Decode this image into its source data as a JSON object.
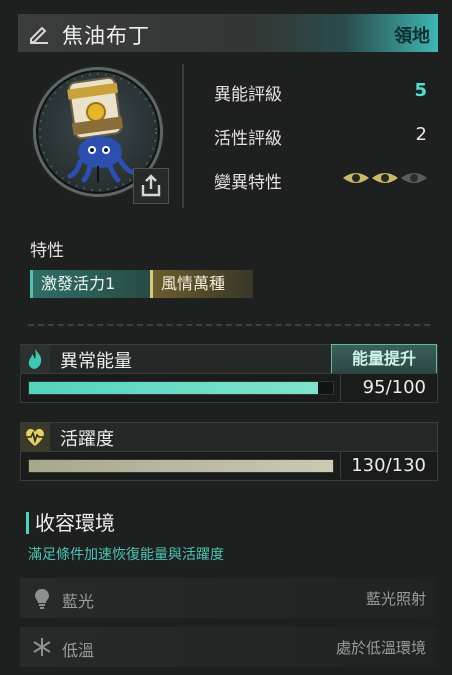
{
  "header": {
    "name": "焦油布丁",
    "tag": "領地",
    "edit_icon": "pencil-icon"
  },
  "stats": [
    {
      "label": "異能評級",
      "value": "5"
    },
    {
      "label": "活性評級",
      "value": "2"
    },
    {
      "label": "變異特性",
      "value": ""
    }
  ],
  "mutation_eyes": {
    "filled": 2,
    "total": 3
  },
  "traits": {
    "title": "特性",
    "chips": [
      "激發活力1",
      "風情萬種"
    ]
  },
  "energy": {
    "title": "異常能量",
    "boost_label": "能量提升",
    "value_text": "95/100",
    "fill": 0.95
  },
  "vitality": {
    "title": "活躍度",
    "value_text": "130/130",
    "fill": 1.0
  },
  "environment": {
    "title": "收容環境",
    "subtitle": "滿足條件加速恢復能量與活躍度",
    "rows": [
      {
        "icon": "lightbulb-icon",
        "label": "藍光",
        "value": "藍光照射"
      },
      {
        "icon": "snowflake-icon",
        "label": "低溫",
        "value": "處於低溫環境"
      }
    ]
  },
  "colors": {
    "accent_teal": "#4fe0d0",
    "energy_bar": "#55d3bc",
    "vitality_bar": "#cbcab2",
    "trait_gold": "#d9c77c"
  }
}
